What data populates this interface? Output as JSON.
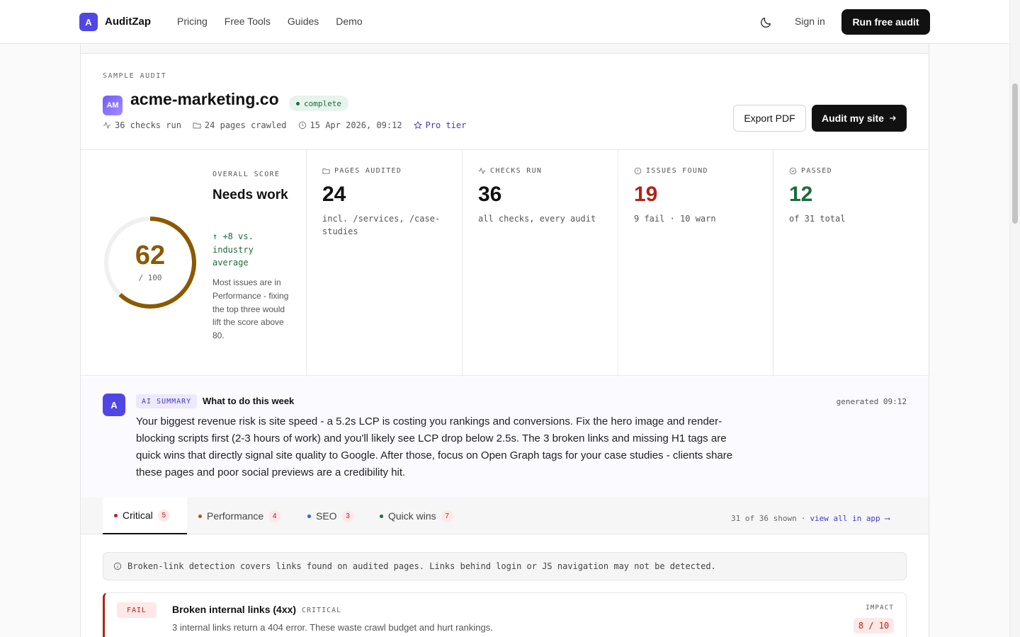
{
  "nav": {
    "logo_letter": "A",
    "brand": "AuditZap",
    "links": [
      "Pricing",
      "Free Tools",
      "Guides",
      "Demo"
    ],
    "signin": "Sign in",
    "cta": "Run free audit"
  },
  "header": {
    "sample_label": "SAMPLE AUDIT",
    "avatar": "AM",
    "domain": "acme-marketing.co",
    "status": "complete",
    "meta": {
      "checks": "36 checks run",
      "pages": "24 pages crawled",
      "date": "15 Apr 2026, 09:12",
      "tier": "Pro tier"
    },
    "export_label": "Export PDF",
    "audit_label": "Audit my site"
  },
  "score": {
    "value": "62",
    "max": "/ 100",
    "fraction": 0.62,
    "label": "OVERALL SCORE",
    "title": "Needs work",
    "delta": "↑ +8 vs. industry average",
    "desc": "Most issues are in Performance - fixing the top three would lift the score above 80."
  },
  "stats": [
    {
      "label": "PAGES AUDITED",
      "value": "24",
      "sub": "incl. /services, /case-studies",
      "color": "#111111"
    },
    {
      "label": "CHECKS RUN",
      "value": "36",
      "sub": "all checks, every audit",
      "color": "#111111"
    },
    {
      "label": "ISSUES FOUND",
      "value": "19",
      "sub": "9 fail · 10 warn",
      "color": "#b42318"
    },
    {
      "label": "PASSED",
      "value": "12",
      "sub": "of 31 total",
      "color": "#1d6b3e"
    }
  ],
  "ai": {
    "avatar": "A",
    "badge": "AI SUMMARY",
    "heading": "What to do this week",
    "generated": "generated 09:12",
    "body": "Your biggest revenue risk is site speed - a 5.2s LCP is costing you rankings and conversions. Fix the hero image and render-blocking scripts first (2-3 hours of work) and you'll likely see LCP drop below 2.5s. The 3 broken links and missing H1 tags are quick wins that directly signal site quality to Google. After those, focus on Open Graph tags for your case studies - clients share these pages and poor social previews are a credibility hit."
  },
  "tabs": [
    {
      "label": "Critical",
      "count": "5",
      "dot": "#b42318"
    },
    {
      "label": "Performance",
      "count": "4",
      "dot": "#b45309"
    },
    {
      "label": "SEO",
      "count": "3",
      "dot": "#2563eb"
    },
    {
      "label": "Quick wins",
      "count": "7",
      "dot": "#1d6b3e"
    }
  ],
  "tabs_right": {
    "shown": "31 of 36 shown",
    "sep": "·",
    "link": "view all in app ⟶"
  },
  "notice": "Broken-link detection covers links found on audited pages. Links behind login or JS navigation may not be detected.",
  "issue": {
    "badge": "FAIL",
    "title": "Broken internal links (4xx)",
    "category": "CRITICAL",
    "desc": "3 internal links return a 404 error. These waste crawl budget and hurt rankings.",
    "impact_label": "IMPACT",
    "impact": "8 / 10"
  },
  "colors": {
    "accent": "#4f46e5",
    "score": "#8a5a00",
    "fail": "#b42318",
    "pass": "#1d6b3e"
  }
}
